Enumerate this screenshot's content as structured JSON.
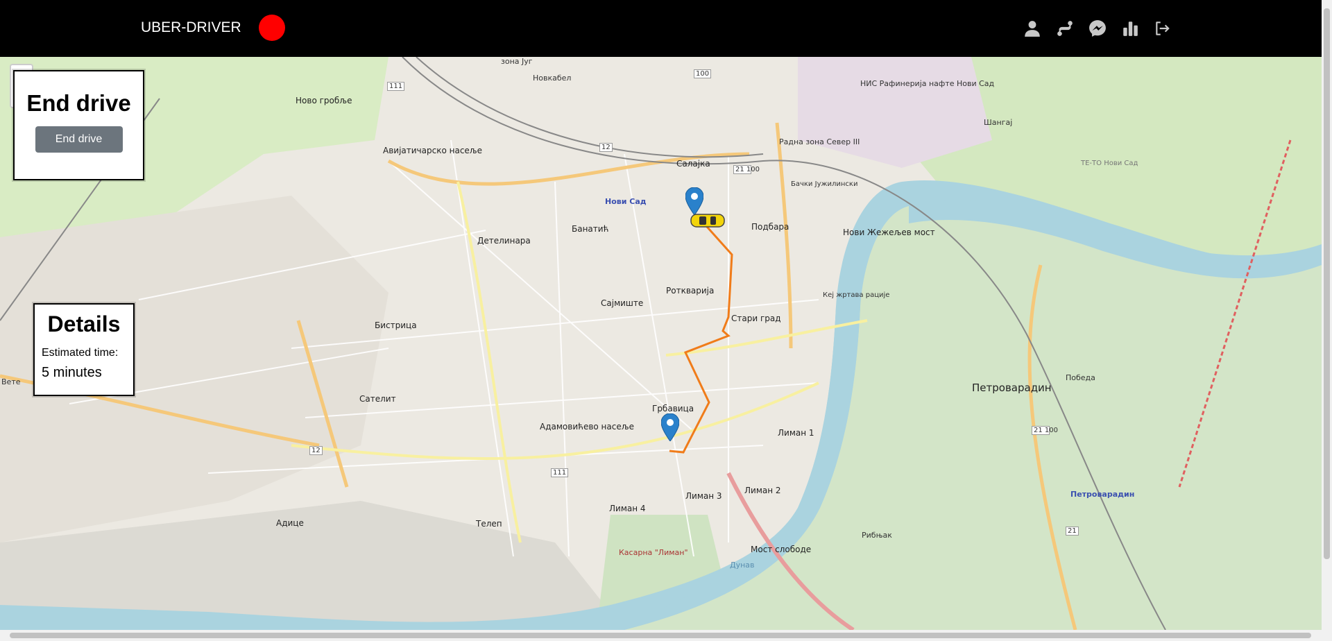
{
  "navbar": {
    "brand": "UBER-DRIVER",
    "status_color": "#ff0000",
    "icons": [
      "user-icon",
      "route-icon",
      "messenger-icon",
      "chart-icon",
      "logout-icon"
    ]
  },
  "end_drive": {
    "title": "End drive",
    "button_label": "End drive"
  },
  "details": {
    "title": "Details",
    "estimated_time_label": "Estimated time:",
    "estimated_time_value": "5 minutes"
  },
  "map": {
    "labels": [
      "зона Југ",
      "Новкабел",
      "Ново гробље",
      "Авијатичарско насеље",
      "Салајка",
      "Радна зона Север III",
      "НИС Рафинерија нафте Нови Сад",
      "Шангај",
      "ТЕ-ТО Нови Сад",
      "Нови Сад",
      "Банатић",
      "Детелинара",
      "Подбара",
      "Нови Жежељев мост",
      "Сајмиште",
      "Ротквариja",
      "Стари град",
      "Бистрица",
      "Сателит",
      "Петроварадин",
      "Победа",
      "Грбавица",
      "Адамовићево насеље",
      "Лиман 1",
      "Лиман 2",
      "Лиман 3",
      "Лиман 4",
      "Адице",
      "Телеп",
      "Мост слободе",
      "Рибњак",
      "Касарна \"Лиман\"",
      "Дунав",
      "Кеј жртава рације",
      "Бачки Јужилински",
      "Петроварадин",
      "Вете"
    ],
    "road_numbers": [
      "111",
      "100",
      "12",
      "21 100",
      "12",
      "111",
      "21 100",
      "21"
    ]
  },
  "chart_data": null
}
